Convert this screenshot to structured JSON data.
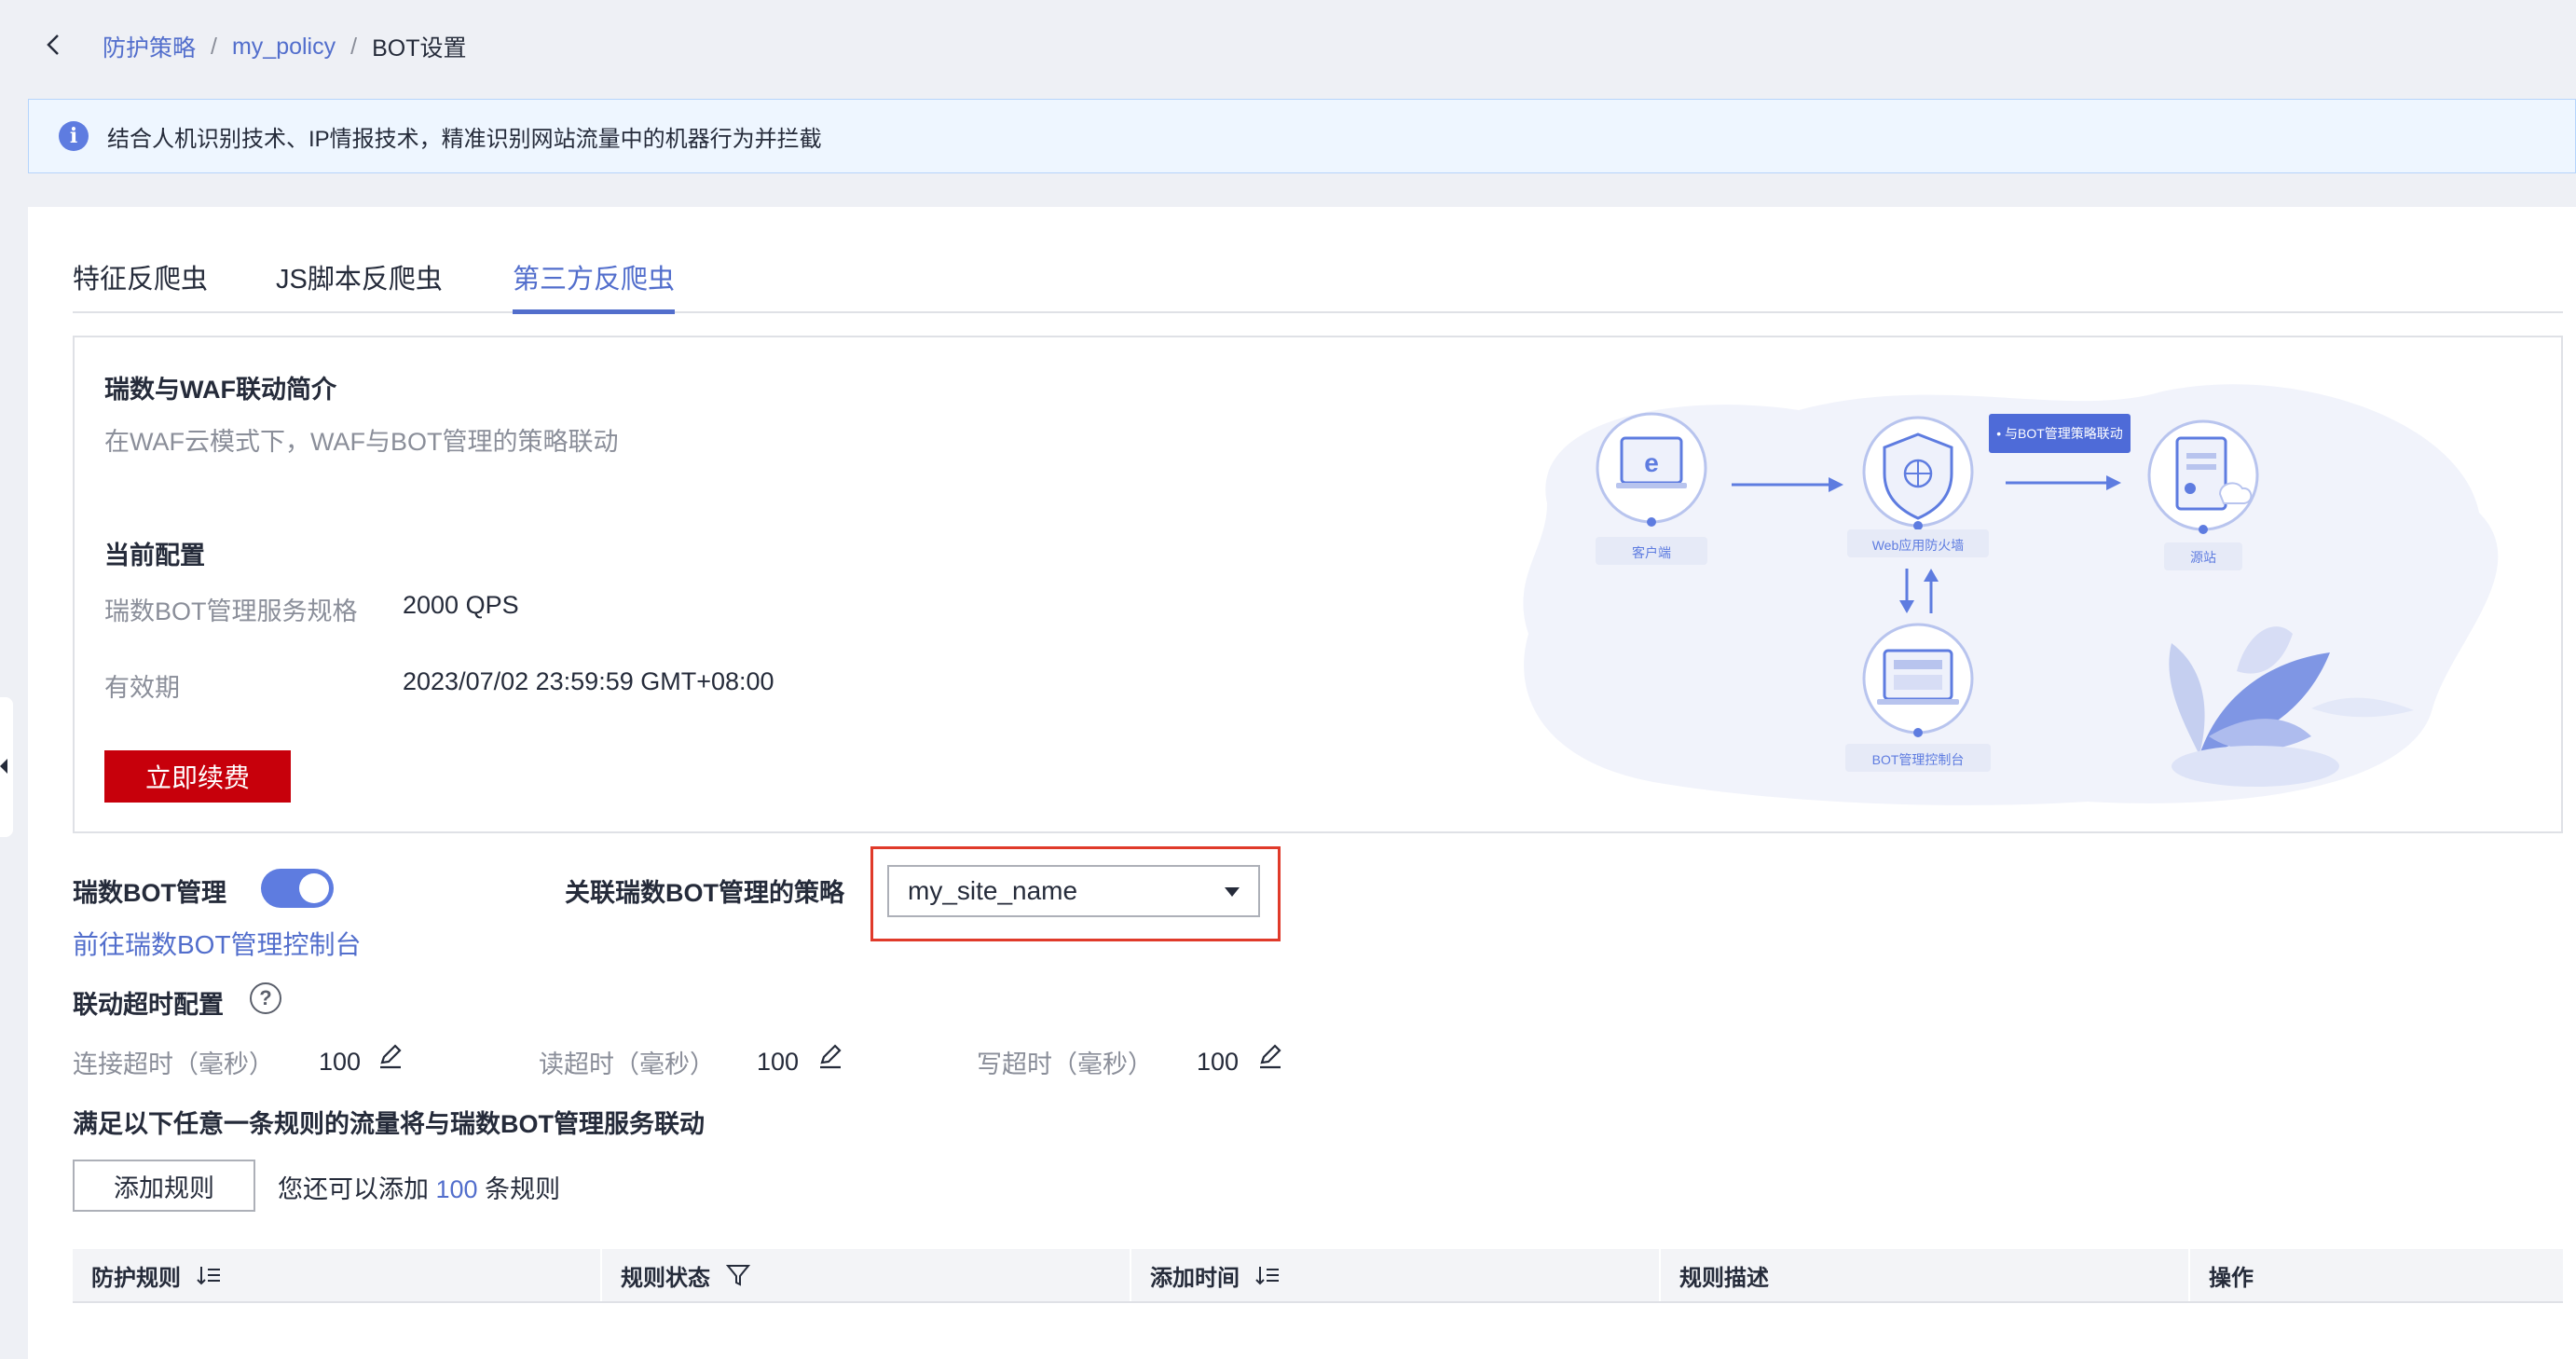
{
  "breadcrumb": {
    "items": [
      "防护策略",
      "my_policy"
    ],
    "separator": "/",
    "current": "BOT设置"
  },
  "banner": {
    "icon": "info-icon",
    "text": "结合人机识别技术、IP情报技术，精准识别网站流量中的机器行为并拦截"
  },
  "tabs": [
    {
      "label": "特征反爬虫",
      "active": false
    },
    {
      "label": "JS脚本反爬虫",
      "active": false
    },
    {
      "label": "第三方反爬虫",
      "active": true
    }
  ],
  "intro": {
    "title": "瑞数与WAF联动简介",
    "description": "在WAF云模式下，WAF与BOT管理的策略联动",
    "config_title": "当前配置",
    "spec_label": "瑞数BOT管理服务规格",
    "spec_value": "2000 QPS",
    "expiry_label": "有效期",
    "expiry_value": "2023/07/02 23:59:59 GMT+08:00",
    "renew_label": "立即续费"
  },
  "diagram": {
    "client": "客户端",
    "waf": "Web应用防火墙",
    "origin": "源站",
    "console": "BOT管理控制台",
    "badge": "• 与BOT管理策略联动"
  },
  "bot": {
    "label": "瑞数BOT管理",
    "enabled": true,
    "console_link": "前往瑞数BOT管理控制台",
    "policy_label": "关联瑞数BOT管理的策略",
    "policy_value": "my_site_name"
  },
  "timeout": {
    "title": "联动超时配置",
    "connect_label": "连接超时（毫秒）",
    "connect_value": "100",
    "read_label": "读超时（毫秒）",
    "read_value": "100",
    "write_label": "写超时（毫秒）",
    "write_value": "100"
  },
  "rules": {
    "title": "满足以下任意一条规则的流量将与瑞数BOT管理服务联动",
    "add_label": "添加规则",
    "remain_prefix": "您还可以添加",
    "remain_count": "100",
    "remain_suffix": "条规则"
  },
  "table": {
    "columns": [
      "防护规则",
      "规则状态",
      "添加时间",
      "规则描述",
      "操作"
    ]
  },
  "colors": {
    "accent": "#526ecc",
    "renew": "#c7000b",
    "highlight": "#e03a2a",
    "toggle_on": "#5e7ce0"
  }
}
